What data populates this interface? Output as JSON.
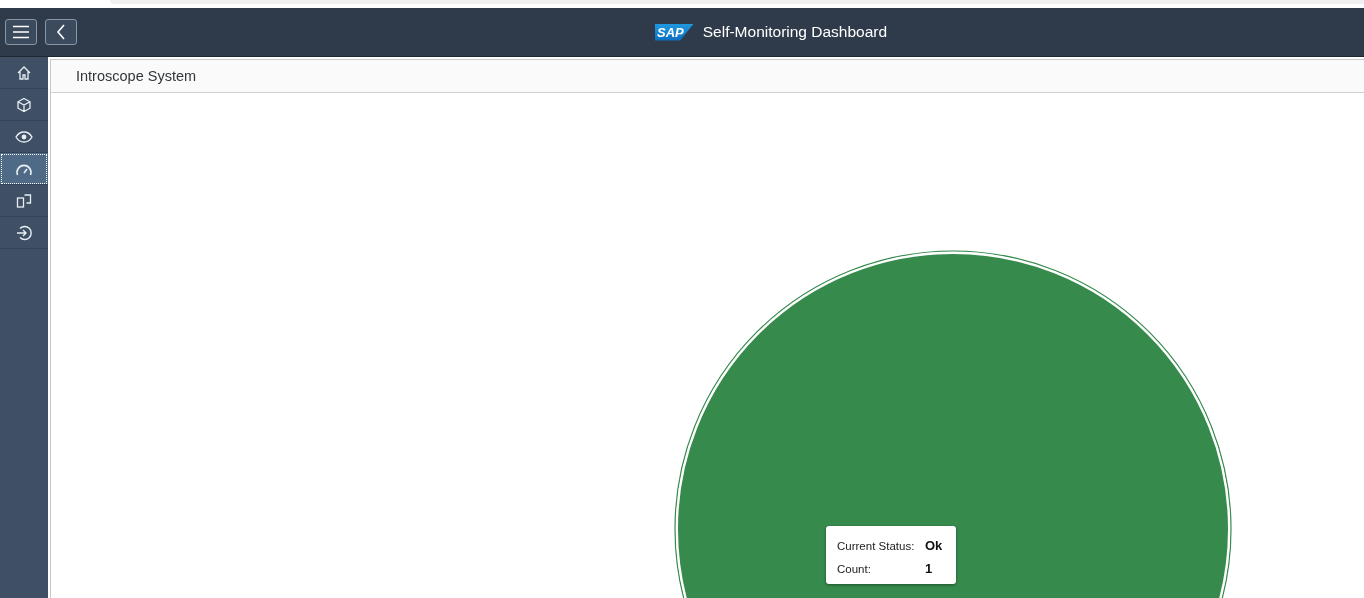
{
  "shell": {
    "logo": "SAP",
    "title": "Self-Monitoring Dashboard"
  },
  "sidebar": {
    "items": [
      {
        "kind": "home",
        "selected": false
      },
      {
        "kind": "cube",
        "selected": false
      },
      {
        "kind": "eye",
        "selected": false
      },
      {
        "kind": "gauge",
        "selected": true
      },
      {
        "kind": "devices",
        "selected": false
      },
      {
        "kind": "exit",
        "selected": false
      }
    ]
  },
  "page": {
    "title": "Introscope System"
  },
  "chart": {
    "tooltip": [
      {
        "label": "Current Status:",
        "value": "Ok"
      },
      {
        "label": "Count:",
        "value": "1"
      }
    ]
  }
}
